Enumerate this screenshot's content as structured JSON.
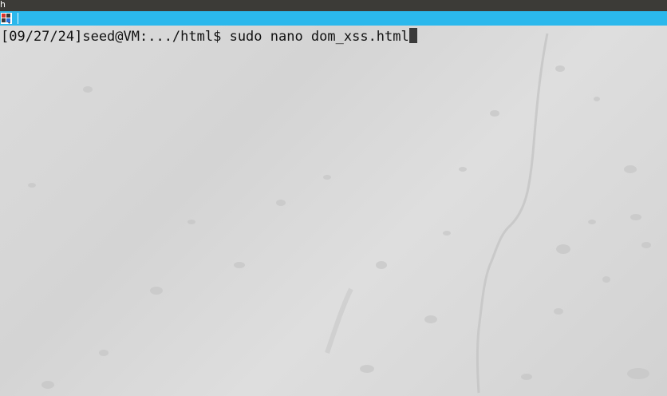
{
  "window": {
    "title": "h"
  },
  "terminal": {
    "prompt": "[09/27/24]seed@VM:.../html$ ",
    "command": "sudo nano dom_xss.html"
  },
  "icons": {
    "app": "terminal-app-icon",
    "cursor": "text-cursor-block"
  },
  "colors": {
    "titlebar": "#3c3b37",
    "tabbar": "#2bb8ec",
    "background": "#d8d8d8",
    "text": "#111111"
  }
}
